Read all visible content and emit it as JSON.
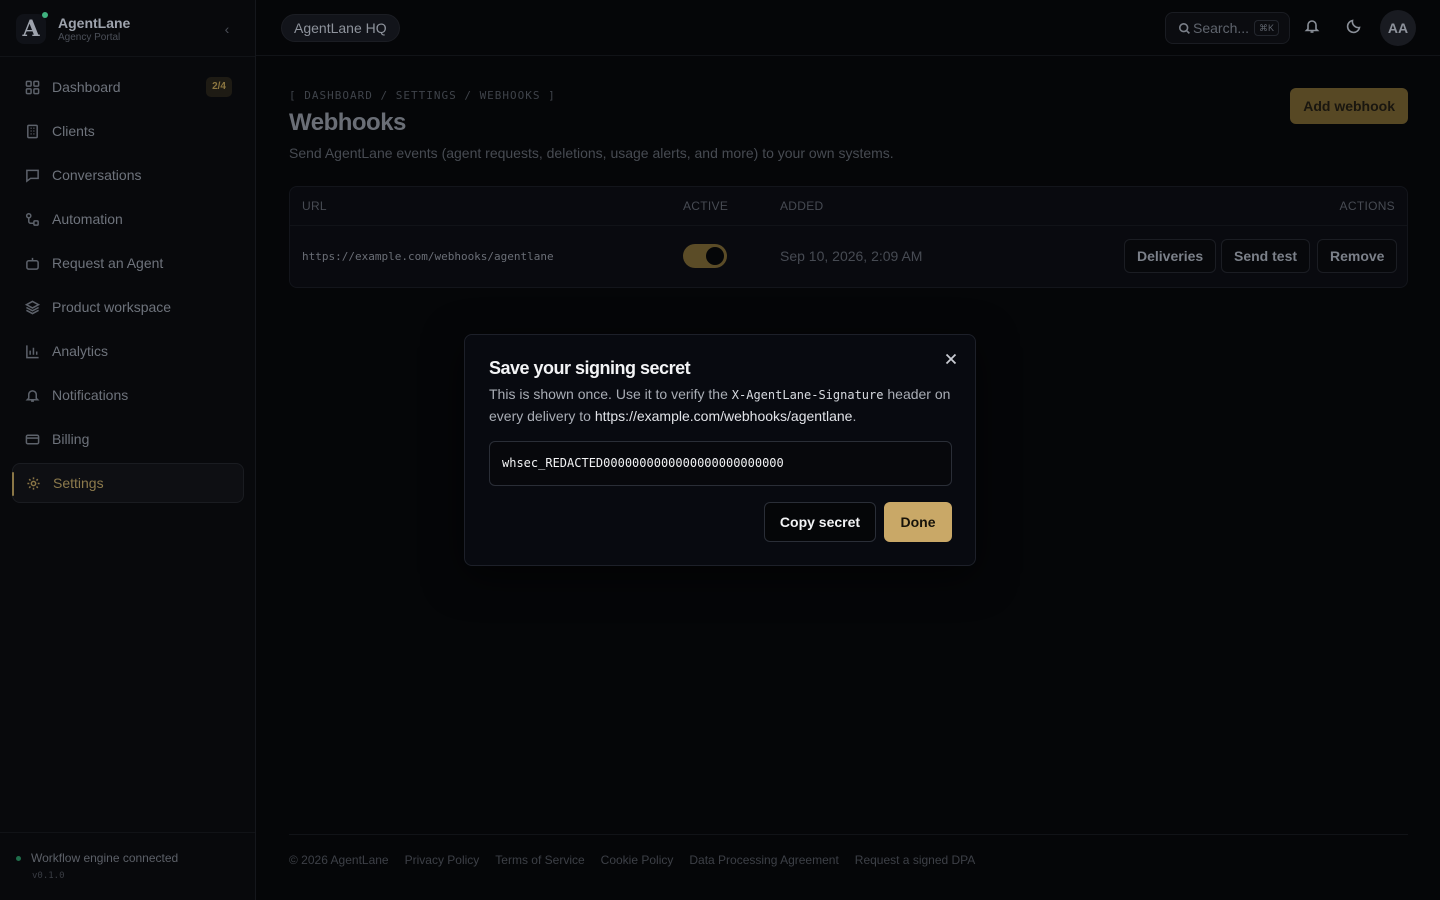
{
  "brand": {
    "name": "AgentLane",
    "subtitle": "Agency Portal",
    "logo_letter": "A"
  },
  "sidebar": {
    "items": [
      {
        "label": "Dashboard",
        "icon": "grid-icon",
        "badge": "2/4"
      },
      {
        "label": "Clients",
        "icon": "building-icon"
      },
      {
        "label": "Conversations",
        "icon": "chat-icon"
      },
      {
        "label": "Automation",
        "icon": "workflow-icon"
      },
      {
        "label": "Request an Agent",
        "icon": "bot-icon"
      },
      {
        "label": "Product workspace",
        "icon": "layers-icon"
      },
      {
        "label": "Analytics",
        "icon": "bar-chart-icon"
      },
      {
        "label": "Notifications",
        "icon": "bell-icon"
      },
      {
        "label": "Billing",
        "icon": "card-icon"
      },
      {
        "label": "Settings",
        "icon": "gear-icon",
        "active": true
      }
    ],
    "status": "Workflow engine connected",
    "version": "v0.1.0"
  },
  "topbar": {
    "workspace": "AgentLane HQ",
    "search_placeholder": "Search...",
    "search_shortcut": "⌘K",
    "avatar_initials": "AA"
  },
  "page": {
    "breadcrumb": "[ DASHBOARD / SETTINGS / WEBHOOKS ]",
    "title": "Webhooks",
    "description": "Send AgentLane events (agent requests, deletions, usage alerts, and more) to your own systems.",
    "add_button": "Add webhook"
  },
  "table": {
    "headers": {
      "url": "URL",
      "active": "ACTIVE",
      "added": "ADDED",
      "actions": "ACTIONS"
    },
    "rows": [
      {
        "url": "https://example.com/webhooks/agentlane",
        "active": true,
        "added": "Sep 10, 2026, 2:09 AM",
        "actions": {
          "deliveries": "Deliveries",
          "send_test": "Send test",
          "remove": "Remove"
        }
      }
    ]
  },
  "footer": {
    "copyright": "© 2026 AgentLane",
    "links": [
      "Privacy Policy",
      "Terms of Service",
      "Cookie Policy",
      "Data Processing Agreement",
      "Request a signed DPA"
    ]
  },
  "modal": {
    "title": "Save your signing secret",
    "text_before": "This is shown once. Use it to verify the ",
    "header_name": "X-AgentLane-Signature",
    "text_middle": " header on every delivery to ",
    "url": "https://example.com/webhooks/agentlane",
    "text_end": ".",
    "secret": "whsec_REDACTED0000000000000000000000000",
    "copy_button": "Copy secret",
    "done_button": "Done"
  },
  "colors": {
    "accent": "#c9a867",
    "background": "#050608",
    "status_green": "#1f6e4b"
  }
}
